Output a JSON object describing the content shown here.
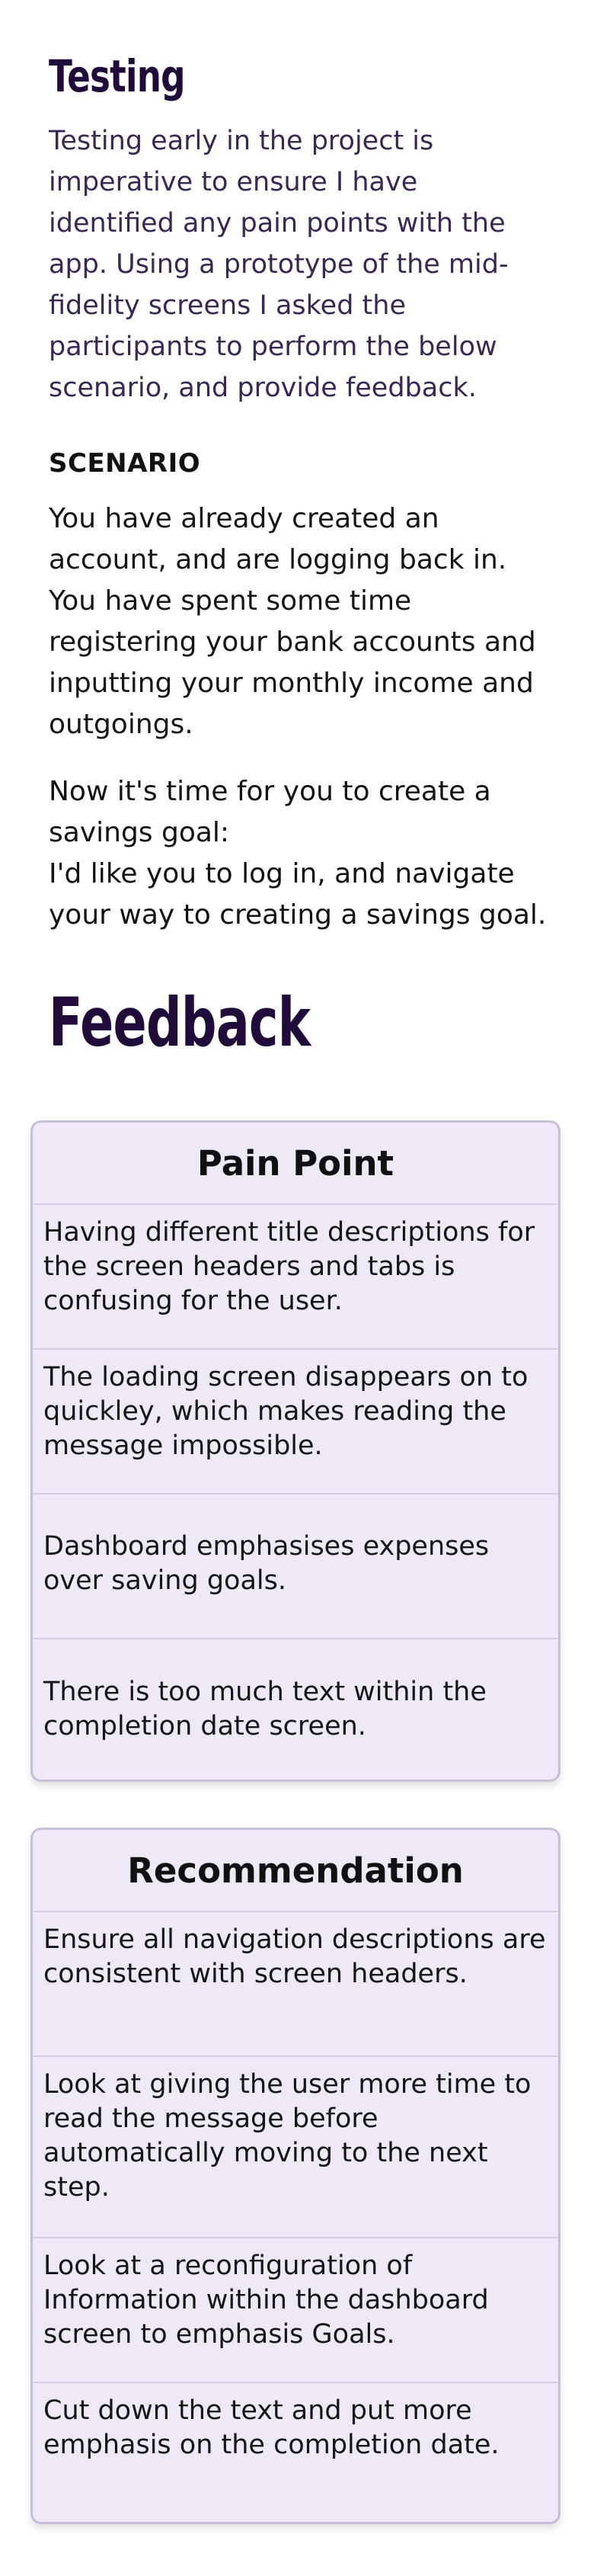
{
  "testing": {
    "title": "Testing",
    "intro": "Testing early in the project is imperative to ensure I have identified any pain points with the app. Using a prototype of the mid-fidelity screens I asked the participants to perform the below scenario, and provide feedback.",
    "scenario_label": "SCENARIO",
    "scenario_text": "You have already created an account, and are logging back in. You have spent some time registering your bank accounts and inputting your monthly income and outgoings.",
    "task_line1": "Now it's time for you to create a savings goal:",
    "task_line2": "I'd like you to log in, and navigate your way to creating a savings goal."
  },
  "feedback": {
    "title": "Feedback",
    "pain_points": {
      "header": "Pain Point",
      "items": [
        "Having different title descriptions for the screen headers and tabs is confusing for the user.",
        "The loading screen disappears on to quickley, which makes reading the message impossible.",
        "Dashboard emphasises expenses over saving goals.",
        "There is too much text within the completion date screen."
      ]
    },
    "recommendations": {
      "header": "Recommendation",
      "items": [
        "Ensure all navigation descriptions are consistent with screen headers.",
        "Look at giving the user more time to read the message before automatically moving to the next step.",
        "Look at a reconfiguration of Information within the dashboard screen to emphasis Goals.",
        "Cut down the text and put more emphasis on the completion date."
      ]
    }
  },
  "colors": {
    "heading": "#200b3b",
    "intro_text": "#3a2754",
    "card_bg": "#efe9f7",
    "card_border": "#c9bdd9"
  }
}
